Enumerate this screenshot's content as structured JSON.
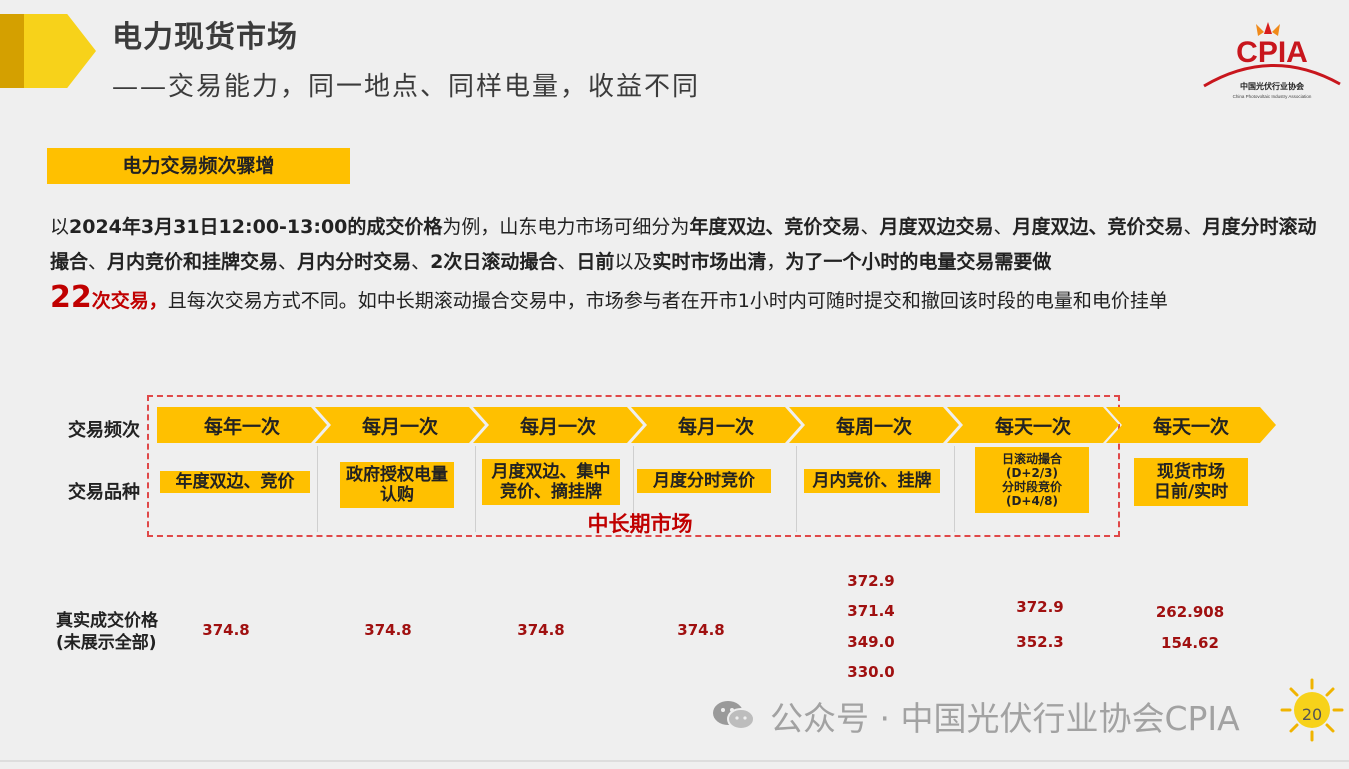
{
  "header": {
    "title": "电力现货市场",
    "subtitle": "——交易能力，同一地点、同样电量，收益不同",
    "logo_text": "CPIA",
    "logo_cn": "中国光伏行业协会",
    "logo_en": "China Photovoltaic Industry Association"
  },
  "section_tag": "电力交易频次骤增",
  "paragraph": {
    "p1": "以",
    "b1": "2024年3月31日12:00-13:00的成交价格",
    "p2": "为例，山东电力市场可细分为",
    "b2": "年度双边、竞价交易",
    "p3": "、",
    "b3": "月度双边交易",
    "p4": "、",
    "b4": "月度双边、竞价交易",
    "p5": "、",
    "b5": "月度分时滚动撮合",
    "p6": "、",
    "b6": "月内竞价和挂牌交易",
    "p7": "、",
    "b7": "月内分时交易",
    "p8": "、",
    "b8": "2次日滚动撮合",
    "p9": "、",
    "b9": "日前",
    "p10": "以及",
    "b10": "实时市场出清",
    "p11": "，",
    "b11": "为了一个小时的电量交易需要做",
    "big": "22",
    "red": "次交易，",
    "p12": "且每次交易方式不同。如中长期滚动撮合交易中，市场参与者在开市1小时内可随时提交和撤回该时段的电量和电价挂单"
  },
  "diagram": {
    "row_freq_label": "交易频次",
    "row_type_label": "交易品种",
    "mid_market_label": "中长期市场",
    "frequencies": [
      "每年一次",
      "每月一次",
      "每月一次",
      "每月一次",
      "每周一次",
      "每天一次",
      "每天一次"
    ],
    "types": {
      "t1": "年度双边、竞价",
      "t2a": "政府授权电量",
      "t2b": "认购",
      "t3a": "月度双边、集中",
      "t3b": "竞价、摘挂牌",
      "t4": "月度分时竞价",
      "t5": "月内竞价、挂牌",
      "t6a": "日滚动撮合",
      "t6b": "(D+2/3)",
      "t6c": "分时段竞价",
      "t6d": "(D+4/8)",
      "t7a": "现货市场",
      "t7b": "日前/实时"
    }
  },
  "prices": {
    "label_1": "真实成交价格",
    "label_2": "(未展示全部)",
    "c1": "374.8",
    "c2": "374.8",
    "c3": "374.8",
    "c4": "374.8",
    "c5": [
      "372.9",
      "371.4",
      "349.0",
      "330.0"
    ],
    "c6": [
      "372.9",
      "352.3"
    ],
    "c7": [
      "262.908",
      "154.62"
    ]
  },
  "watermark": "公众号 · 中国光伏行业协会CPIA",
  "page_number": "20",
  "colors": {
    "accent": "#ffc000",
    "highlight_red": "#c00000",
    "price_red": "#a01010"
  }
}
